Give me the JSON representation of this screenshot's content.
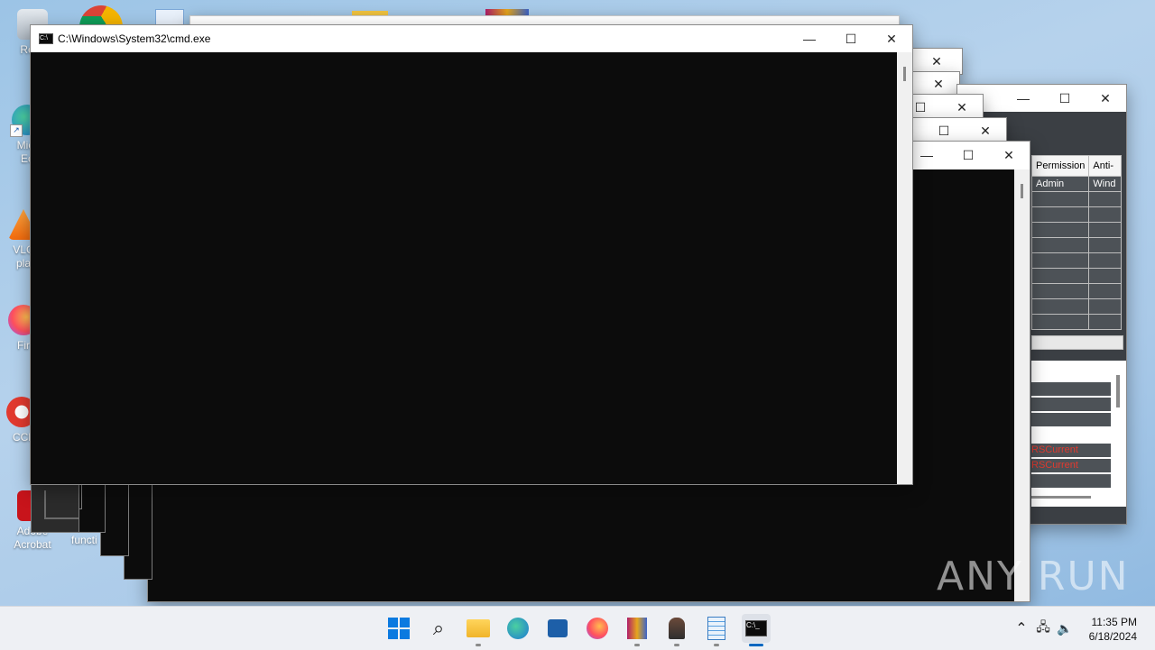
{
  "desktop": {
    "icons": [
      {
        "label": "Recy",
        "label2": ""
      },
      {
        "label": "Micr",
        "label2": "Ec"
      },
      {
        "label": "VLC",
        "label2": "pla"
      },
      {
        "label": "Fir",
        "label2": ""
      },
      {
        "label": "CCl",
        "label2": ""
      },
      {
        "label": "Adobe",
        "label2": "Acrobat"
      }
    ],
    "functi_label": "functi"
  },
  "cmd_window": {
    "title": "C:\\Windows\\System32\\cmd.exe",
    "minimize_glyph": "—",
    "maximize_glyph": "☐",
    "close_glyph": "✕"
  },
  "background_window": {
    "table_headers": [
      "Permission",
      "Anti-"
    ],
    "table_first_row": [
      "Admin",
      "Wind"
    ],
    "log_rows": [
      "RSCurrent",
      "RSCurrent"
    ]
  },
  "watermark": "ANY RUN",
  "taskbar": {
    "apps": [
      "start-icon",
      "search-icon",
      "file-explorer-icon",
      "edge-icon",
      "store-icon",
      "firefox-icon",
      "winrar-icon",
      "user-app-icon",
      "notepad-icon",
      "cmd-icon"
    ],
    "tray_chevron": "^",
    "time": "11:35 PM",
    "date": "6/18/2024"
  }
}
